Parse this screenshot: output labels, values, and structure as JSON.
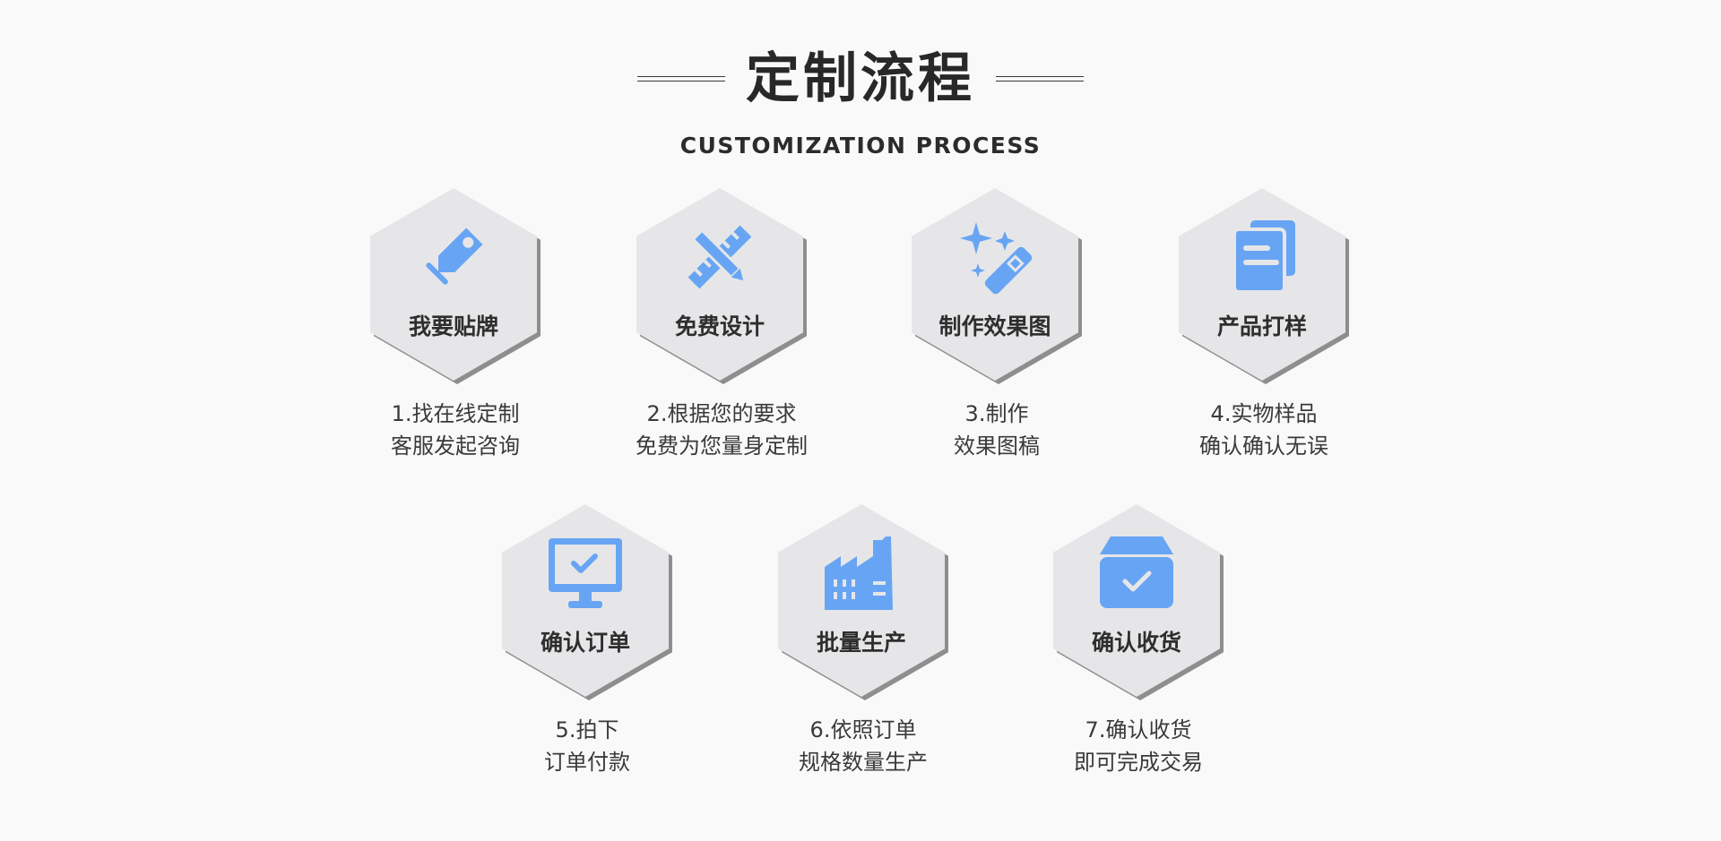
{
  "header": {
    "title": "定制流程",
    "subtitle": "CUSTOMIZATION PROCESS"
  },
  "colors": {
    "icon": "#67a5f4",
    "hexagon": "#e6e6e8",
    "hexagon_shadow": "#8e8e8e",
    "background": "#f9f9f9"
  },
  "steps": [
    {
      "label": "我要贴牌",
      "icon": "tag-icon",
      "desc_line1": "1.找在线定制",
      "desc_line2": "客服发起咨询"
    },
    {
      "label": "免费设计",
      "icon": "pencil-ruler-icon",
      "desc_line1": "2.根据您的要求",
      "desc_line2": "免费为您量身定制"
    },
    {
      "label": "制作效果图",
      "icon": "magic-wand-icon",
      "desc_line1": "3.制作",
      "desc_line2": "效果图稿"
    },
    {
      "label": "产品打样",
      "icon": "documents-icon",
      "desc_line1": "4.实物样品",
      "desc_line2": "确认确认无误"
    },
    {
      "label": "确认订单",
      "icon": "monitor-check-icon",
      "desc_line1": "5.拍下",
      "desc_line2": "订单付款"
    },
    {
      "label": "批量生产",
      "icon": "factory-icon",
      "desc_line1": "6.依照订单",
      "desc_line2": "规格数量生产"
    },
    {
      "label": "确认收货",
      "icon": "box-check-icon",
      "desc_line1": "7.确认收货",
      "desc_line2": "即可完成交易"
    }
  ]
}
